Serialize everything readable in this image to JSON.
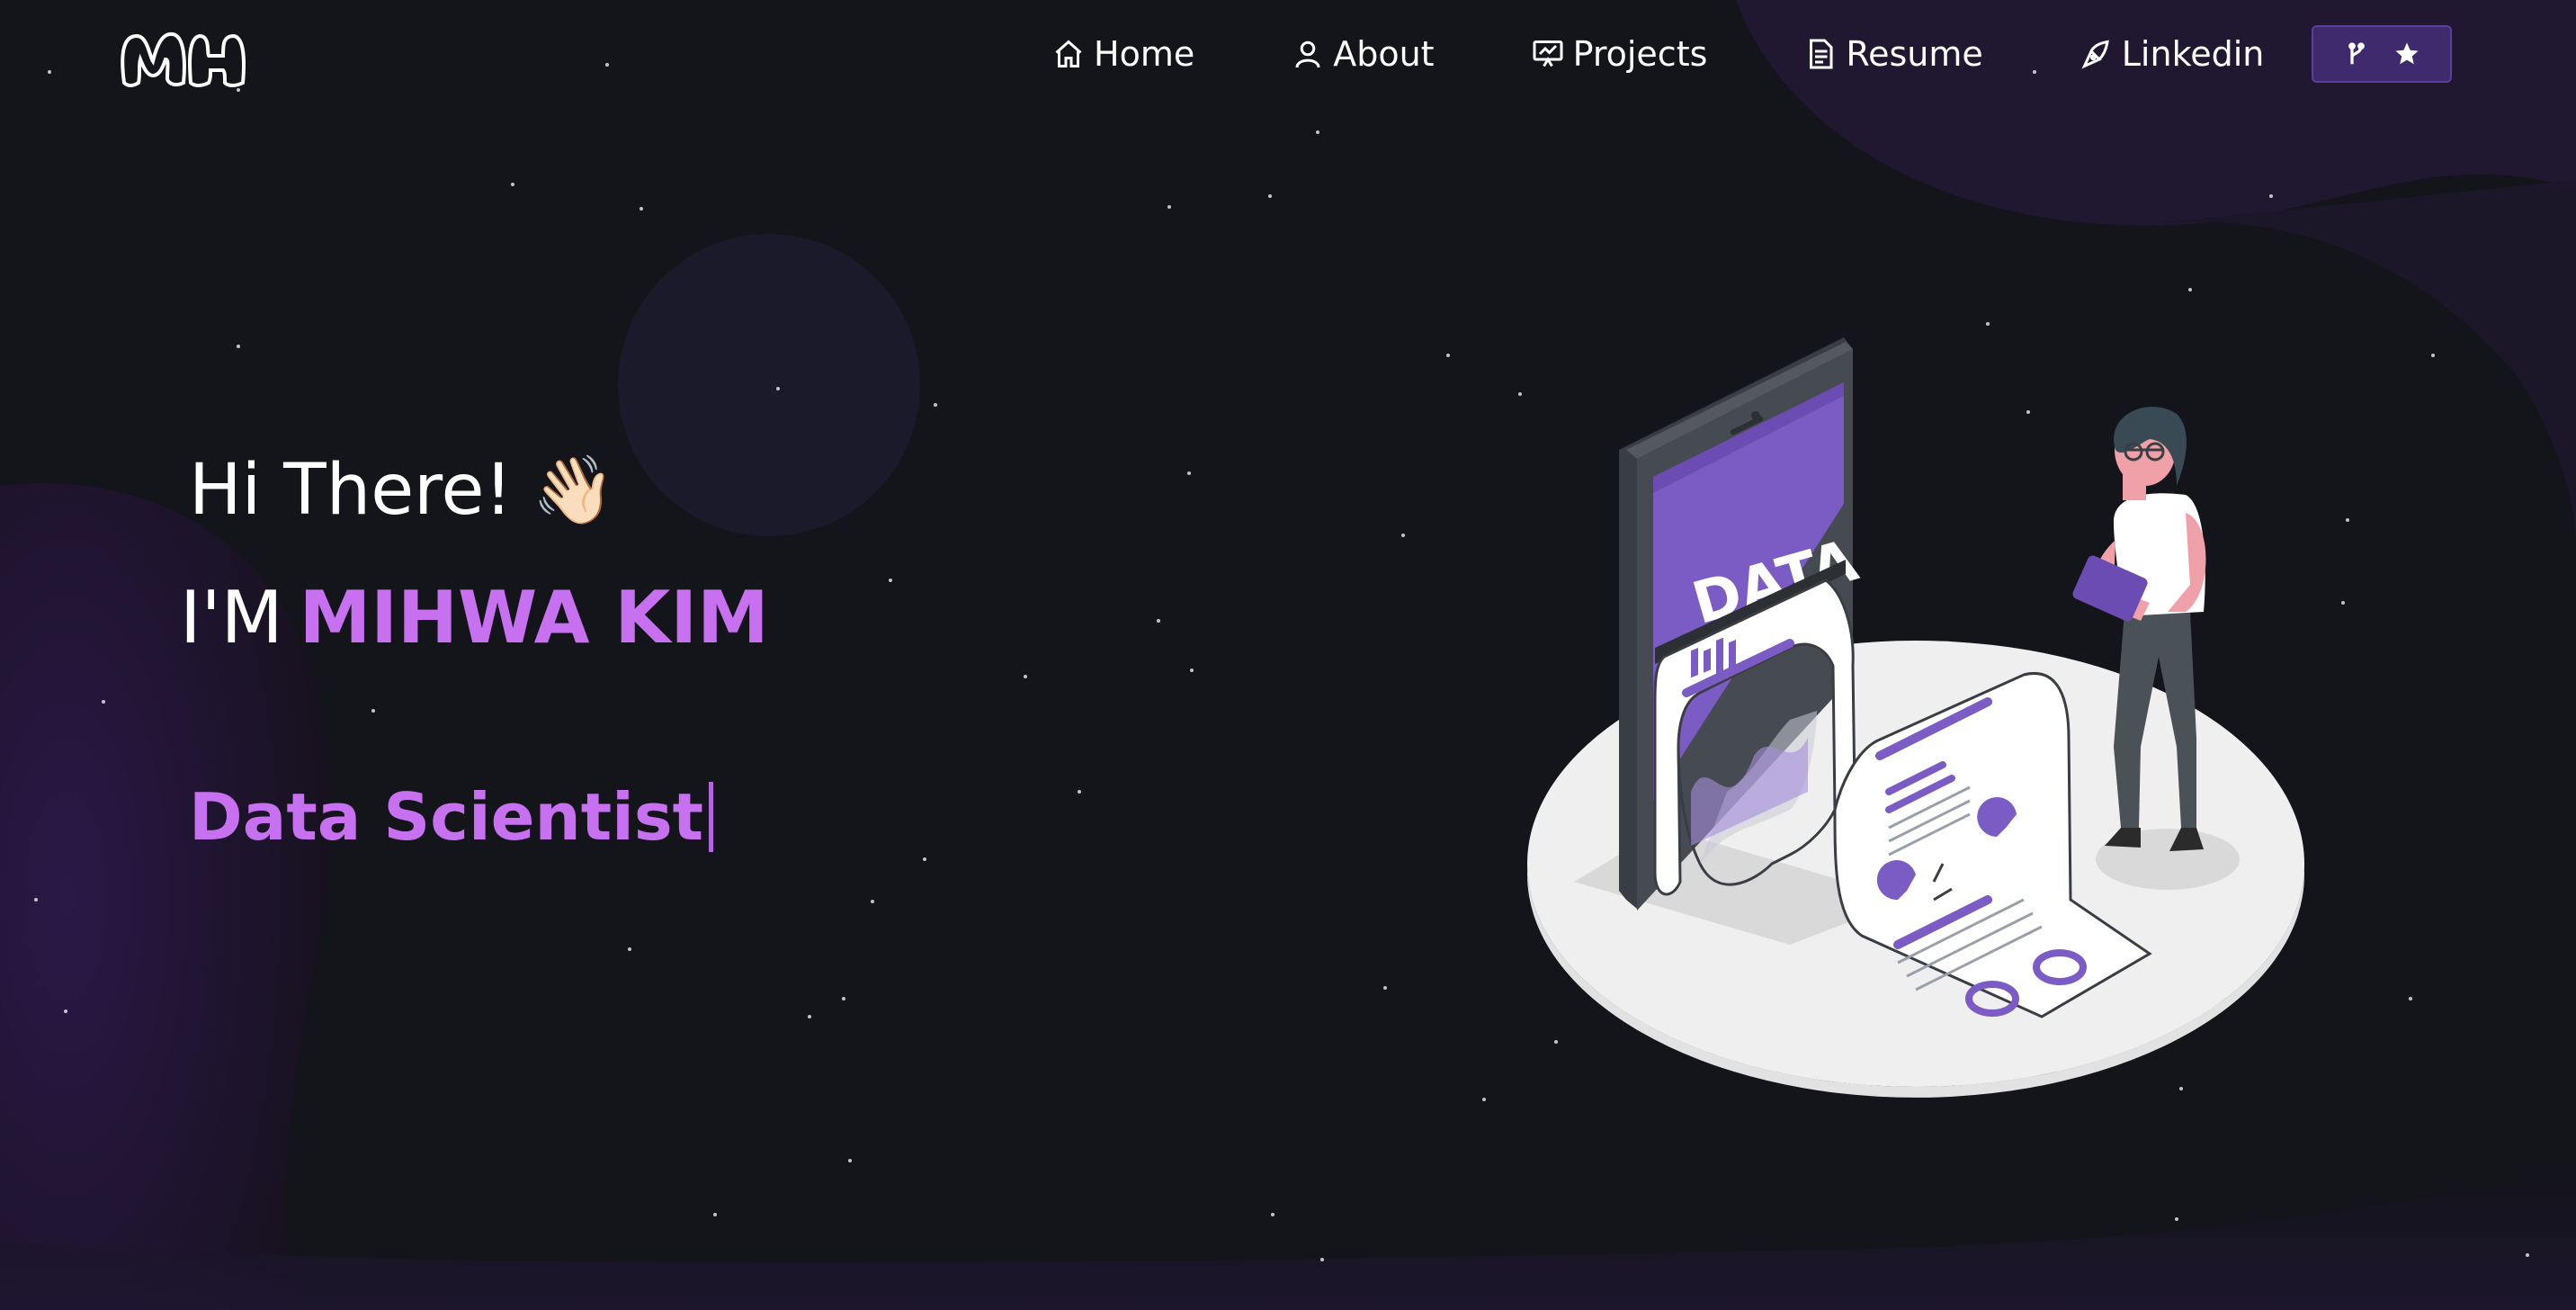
{
  "nav": {
    "logo_text": "MH",
    "items": [
      {
        "label": "Home",
        "icon": "home-icon"
      },
      {
        "label": "About",
        "icon": "user-icon"
      },
      {
        "label": "Projects",
        "icon": "presentation-icon"
      },
      {
        "label": "Resume",
        "icon": "document-icon"
      },
      {
        "label": "Linkedin",
        "icon": "pen-nib-icon"
      }
    ],
    "github_button": {
      "icons": [
        "git-fork-icon",
        "star-icon"
      ]
    }
  },
  "hero": {
    "greeting": "Hi There!",
    "wave_emoji": "👋🏻",
    "intro_prefix": "I'M",
    "name": "MIHWA KIM",
    "typed_role": "Data Scientist"
  },
  "illustration": {
    "screen_text": "DATA"
  },
  "colors": {
    "background": "#14141b",
    "accent": "#c770f0",
    "accent_dark": "#3e2a6d",
    "blob": "#24163f"
  }
}
